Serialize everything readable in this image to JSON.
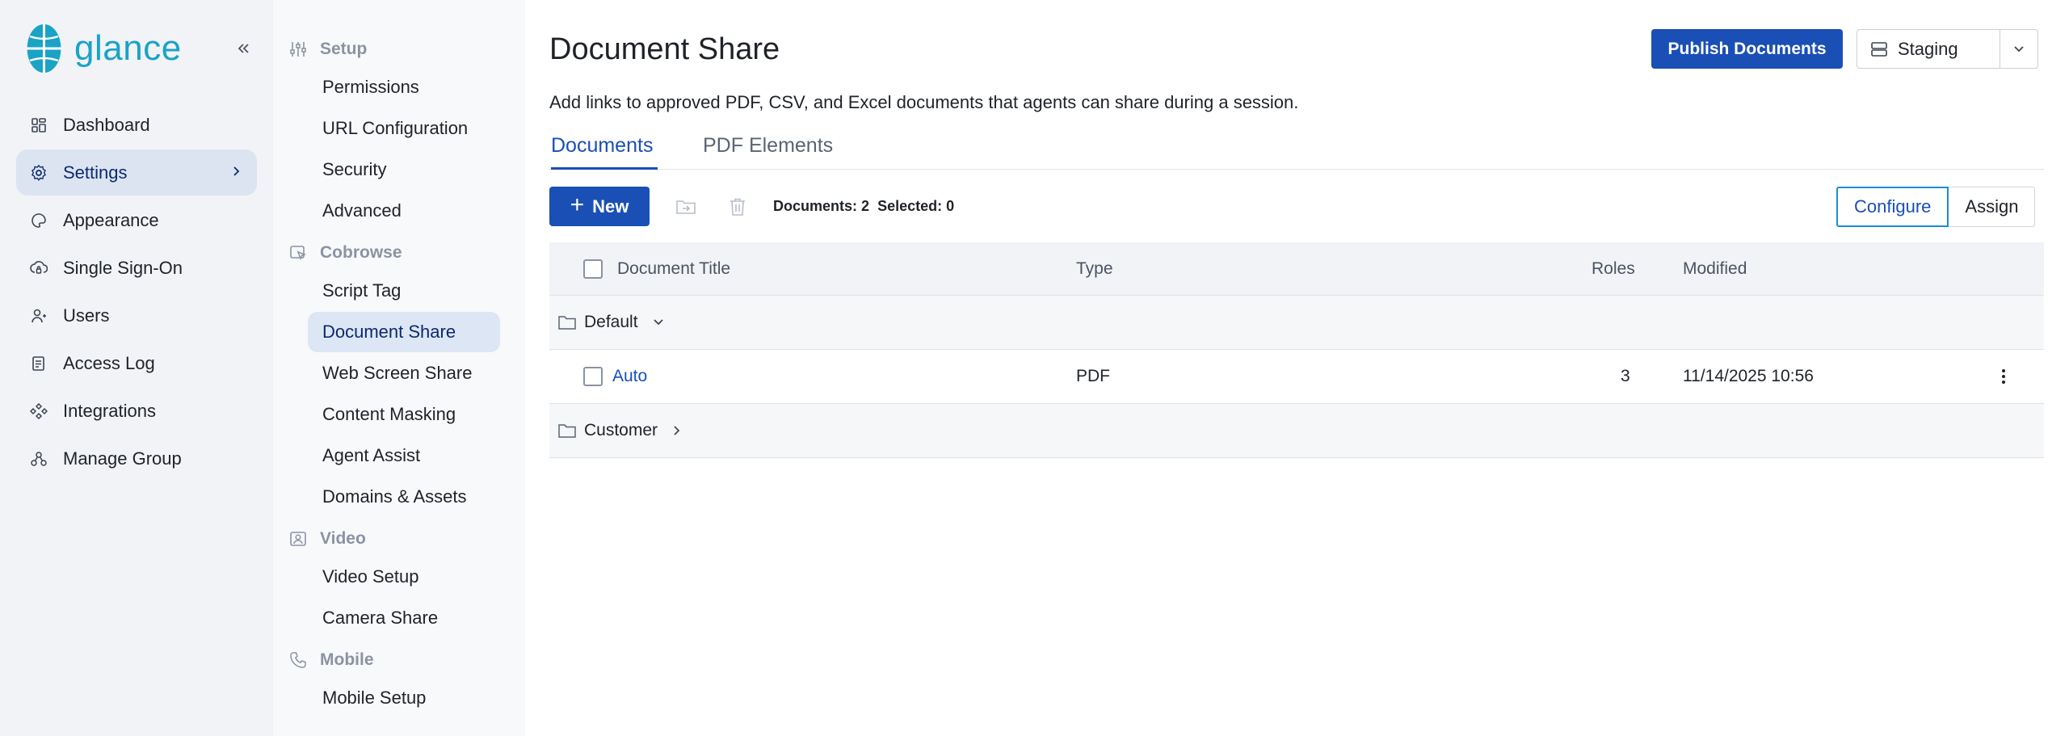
{
  "app": {
    "logo_text": "glance",
    "brand_color": "#1aa3c7",
    "accent_color": "#1a4fb5"
  },
  "nav": {
    "items": [
      {
        "label": "Dashboard",
        "icon": "dashboard-icon"
      },
      {
        "label": "Settings",
        "icon": "gear-icon",
        "active": true
      },
      {
        "label": "Appearance",
        "icon": "palette-icon"
      },
      {
        "label": "Single Sign-On",
        "icon": "sso-icon"
      },
      {
        "label": "Users",
        "icon": "user-icon"
      },
      {
        "label": "Access Log",
        "icon": "log-icon"
      },
      {
        "label": "Integrations",
        "icon": "integrations-icon"
      },
      {
        "label": "Manage Group",
        "icon": "group-icon"
      }
    ]
  },
  "subnav": {
    "setup": {
      "title": "Setup",
      "items": [
        "Permissions",
        "URL Configuration",
        "Security",
        "Advanced"
      ]
    },
    "cobrowse": {
      "title": "Cobrowse",
      "items": [
        "Script Tag",
        "Document Share",
        "Web Screen Share",
        "Content Masking",
        "Agent Assist",
        "Domains & Assets"
      ]
    },
    "video": {
      "title": "Video",
      "items": [
        "Video Setup",
        "Camera Share"
      ]
    },
    "mobile": {
      "title": "Mobile",
      "items": [
        "Mobile Setup"
      ]
    },
    "active_item": "Document Share"
  },
  "main": {
    "title": "Document Share",
    "publish_label": "Publish Documents",
    "environment": "Staging",
    "description": "Add links to approved PDF, CSV, and Excel documents that agents can share during a session.",
    "tabs": [
      {
        "label": "Documents",
        "active": true
      },
      {
        "label": "PDF Elements",
        "active": false
      }
    ],
    "toolbar": {
      "new_label": "New",
      "documents_label": "Documents:",
      "documents_count": "2",
      "selected_label": "Selected:",
      "selected_count": "0",
      "configure_label": "Configure",
      "assign_label": "Assign"
    },
    "table": {
      "headers": {
        "title": "Document Title",
        "type": "Type",
        "roles": "Roles",
        "modified": "Modified"
      },
      "groups": [
        {
          "name": "Default",
          "expanded": true,
          "rows": [
            {
              "title": "Auto",
              "type": "PDF",
              "roles": "3",
              "modified": "11/14/2025 10:56"
            }
          ]
        },
        {
          "name": "Customer",
          "expanded": false,
          "rows": []
        }
      ]
    }
  }
}
